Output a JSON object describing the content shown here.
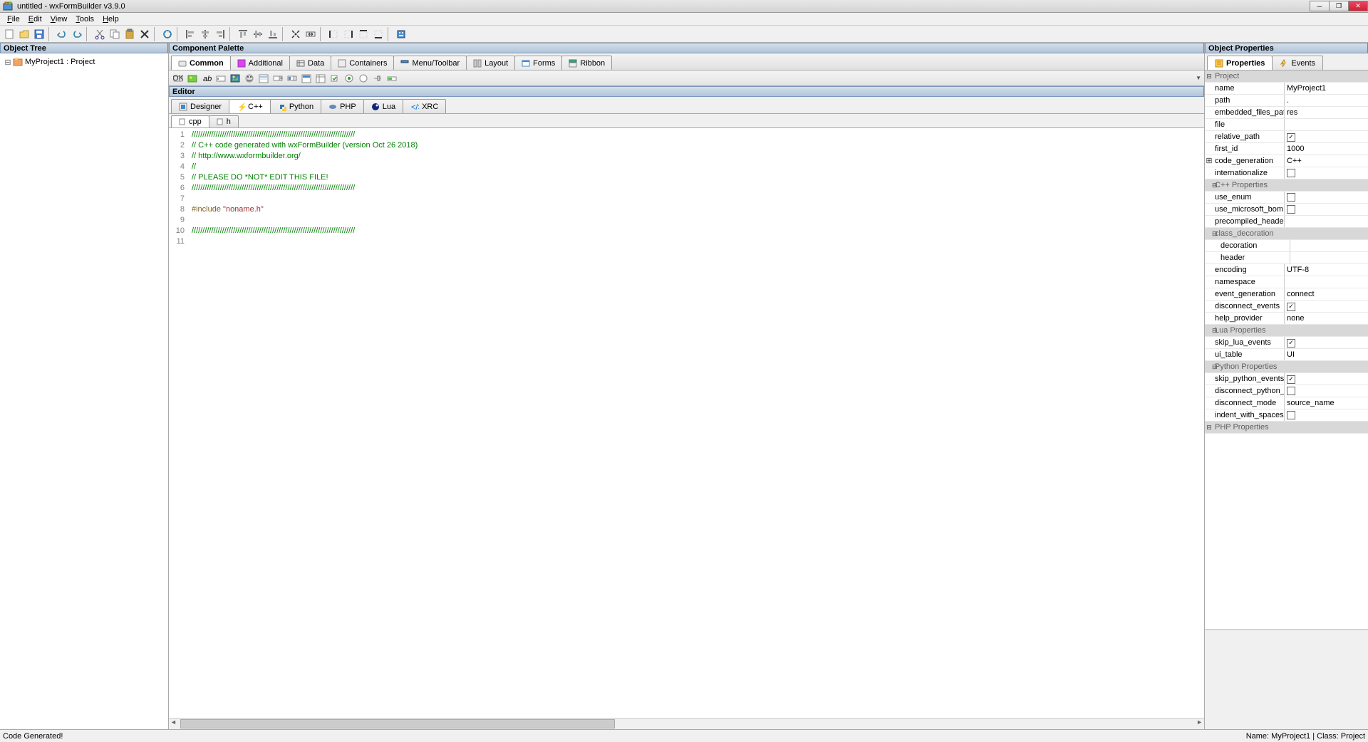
{
  "window": {
    "title": "untitled - wxFormBuilder v3.9.0"
  },
  "menus": [
    "File",
    "Edit",
    "View",
    "Tools",
    "Help"
  ],
  "panels": {
    "object_tree": "Object Tree",
    "component_palette": "Component Palette",
    "editor": "Editor",
    "object_properties": "Object Properties"
  },
  "tree": {
    "root": "MyProject1 : Project"
  },
  "palette_tabs": [
    "Common",
    "Additional",
    "Data",
    "Containers",
    "Menu/Toolbar",
    "Layout",
    "Forms",
    "Ribbon"
  ],
  "editor_tabs": [
    "Designer",
    "C++",
    "Python",
    "PHP",
    "Lua",
    "XRC"
  ],
  "editor_tabs_active": 1,
  "file_tabs": [
    "cpp",
    "h"
  ],
  "file_tabs_active": 0,
  "code_lines": [
    {
      "n": 1,
      "cls": "comment",
      "t": "///////////////////////////////////////////////////////////////////////////"
    },
    {
      "n": 2,
      "cls": "comment",
      "t": "// C++ code generated with wxFormBuilder (version Oct 26 2018)"
    },
    {
      "n": 3,
      "cls": "comment",
      "t": "// http://www.wxformbuilder.org/"
    },
    {
      "n": 4,
      "cls": "comment",
      "t": "//"
    },
    {
      "n": 5,
      "cls": "comment",
      "t": "// PLEASE DO *NOT* EDIT THIS FILE!"
    },
    {
      "n": 6,
      "cls": "comment",
      "t": "///////////////////////////////////////////////////////////////////////////"
    },
    {
      "n": 7,
      "cls": "",
      "t": ""
    },
    {
      "n": 8,
      "cls": "pp",
      "t": "#include \"noname.h\""
    },
    {
      "n": 9,
      "cls": "",
      "t": ""
    },
    {
      "n": 10,
      "cls": "comment",
      "t": "///////////////////////////////////////////////////////////////////////////"
    },
    {
      "n": 11,
      "cls": "",
      "t": ""
    }
  ],
  "prop_tabs": [
    "Properties",
    "Events"
  ],
  "properties": [
    {
      "type": "cat",
      "name": "Project",
      "exp": "-"
    },
    {
      "type": "row",
      "name": "name",
      "val": "MyProject1"
    },
    {
      "type": "row",
      "name": "path",
      "val": "."
    },
    {
      "type": "row",
      "name": "embedded_files_path",
      "val": "res"
    },
    {
      "type": "row",
      "name": "file",
      "val": ""
    },
    {
      "type": "chk",
      "name": "relative_path",
      "checked": true
    },
    {
      "type": "row",
      "name": "first_id",
      "val": "1000"
    },
    {
      "type": "row",
      "name": "code_generation",
      "val": "C++",
      "exp": "+"
    },
    {
      "type": "chk",
      "name": "internationalize",
      "checked": false
    },
    {
      "type": "cat",
      "name": "C++ Properties",
      "exp": "-",
      "indent": 1
    },
    {
      "type": "chk",
      "name": "use_enum",
      "checked": false,
      "indent": 1
    },
    {
      "type": "chk",
      "name": "use_microsoft_bom",
      "checked": false,
      "indent": 1
    },
    {
      "type": "row",
      "name": "precompiled_header",
      "val": "",
      "indent": 1
    },
    {
      "type": "cat",
      "name": "class_decoration",
      "exp": "-",
      "indent": 1
    },
    {
      "type": "row",
      "name": "decoration",
      "val": "",
      "indent": 2
    },
    {
      "type": "row",
      "name": "header",
      "val": "",
      "indent": 2
    },
    {
      "type": "row",
      "name": "encoding",
      "val": "UTF-8",
      "indent": 1
    },
    {
      "type": "row",
      "name": "namespace",
      "val": "",
      "indent": 1
    },
    {
      "type": "row",
      "name": "event_generation",
      "val": "connect",
      "indent": 1
    },
    {
      "type": "chk",
      "name": "disconnect_events",
      "checked": true,
      "indent": 1
    },
    {
      "type": "row",
      "name": "help_provider",
      "val": "none",
      "indent": 1
    },
    {
      "type": "cat",
      "name": "Lua Properties",
      "exp": "-",
      "indent": 1
    },
    {
      "type": "chk",
      "name": "skip_lua_events",
      "checked": true,
      "indent": 1
    },
    {
      "type": "row",
      "name": "ui_table",
      "val": "UI",
      "indent": 1
    },
    {
      "type": "cat",
      "name": "Python Properties",
      "exp": "-",
      "indent": 1
    },
    {
      "type": "chk",
      "name": "skip_python_events",
      "checked": true,
      "indent": 1
    },
    {
      "type": "chk",
      "name": "disconnect_python_events",
      "checked": false,
      "indent": 1
    },
    {
      "type": "row",
      "name": "disconnect_mode",
      "val": "source_name",
      "indent": 1
    },
    {
      "type": "chk",
      "name": "indent_with_spaces",
      "checked": false,
      "indent": 1
    },
    {
      "type": "cat",
      "name": "PHP Properties",
      "exp": "-",
      "indent": 0
    }
  ],
  "status": {
    "left": "Code Generated!",
    "right": "Name: MyProject1 | Class: Project"
  }
}
